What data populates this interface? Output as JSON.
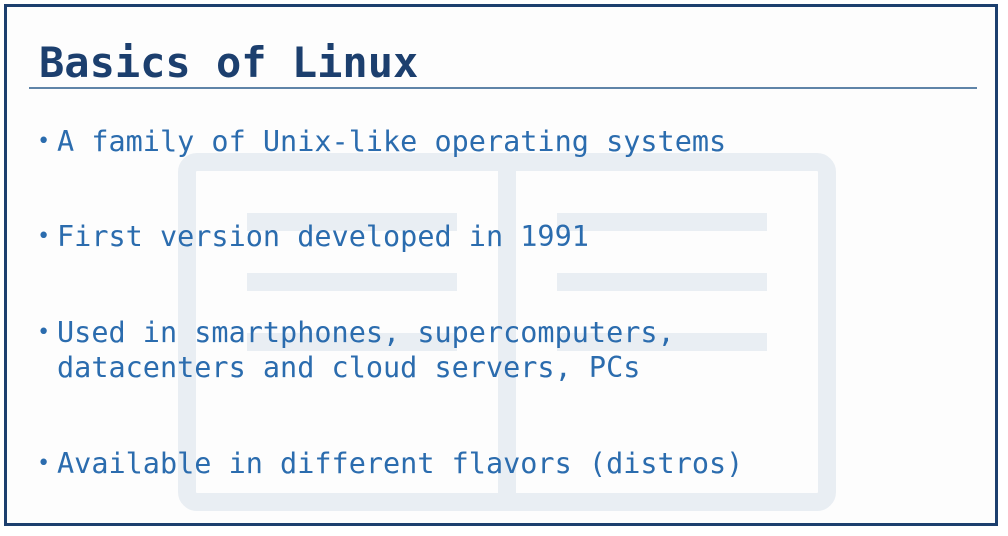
{
  "slide": {
    "title": "Basics of Linux",
    "bullets": [
      "A family of Unix-like operating systems",
      "First version developed in 1991",
      "Used in smartphones, supercomputers,\ndatacenters and cloud servers, PCs",
      "Available in different flavors (distros)"
    ]
  },
  "colors": {
    "title": "#1c3f6e",
    "bullet_text": "#2b6cae",
    "border": "#1c3f6e",
    "rule": "#5f84a8"
  }
}
